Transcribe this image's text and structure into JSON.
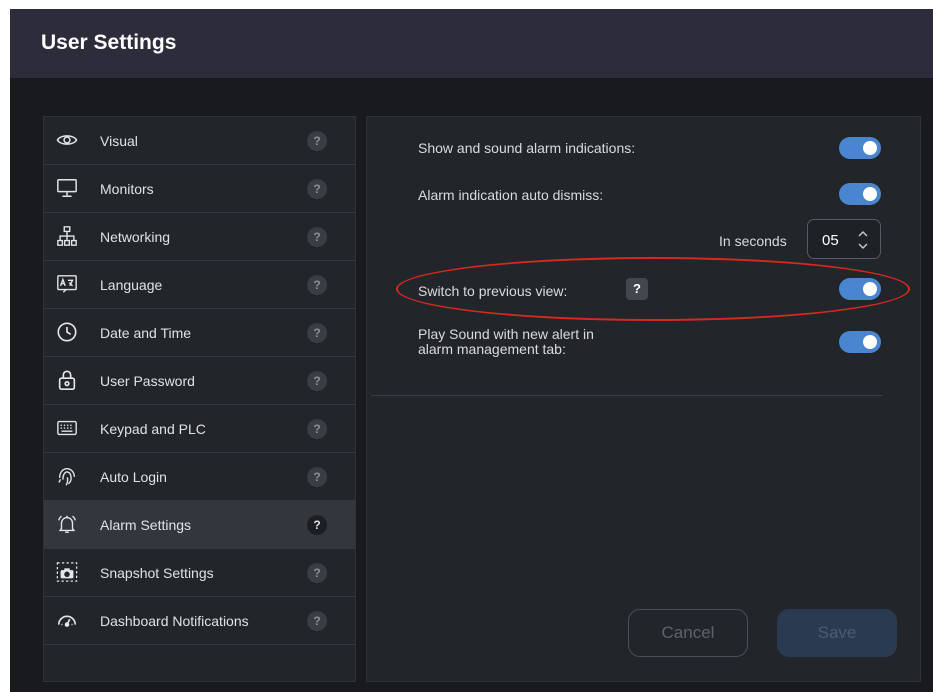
{
  "window": {
    "title": "User Settings"
  },
  "sidebar": {
    "items": [
      {
        "label": "Visual",
        "icon": "eye-icon",
        "help": "?",
        "active": false
      },
      {
        "label": "Monitors",
        "icon": "monitor-icon",
        "help": "?",
        "active": false
      },
      {
        "label": "Networking",
        "icon": "network-icon",
        "help": "?",
        "active": false
      },
      {
        "label": "Language",
        "icon": "language-icon",
        "help": "?",
        "active": false
      },
      {
        "label": "Date and Time",
        "icon": "clock-icon",
        "help": "?",
        "active": false
      },
      {
        "label": "User Password",
        "icon": "lock-icon",
        "help": "?",
        "active": false
      },
      {
        "label": "Keypad and PLC",
        "icon": "keyboard-icon",
        "help": "?",
        "active": false
      },
      {
        "label": "Auto Login",
        "icon": "fingerprint-icon",
        "help": "?",
        "active": false
      },
      {
        "label": "Alarm Settings",
        "icon": "bell-icon",
        "help": "?",
        "active": true
      },
      {
        "label": "Snapshot Settings",
        "icon": "camera-icon",
        "help": "?",
        "active": false
      },
      {
        "label": "Dashboard Notifications",
        "icon": "dashboard-icon",
        "help": "?",
        "active": false
      }
    ]
  },
  "alarm": {
    "show_sound_label": "Show and sound alarm indications:",
    "show_sound_on": true,
    "auto_dismiss_label": "Alarm indication auto dismiss:",
    "auto_dismiss_on": true,
    "seconds_label": "In seconds",
    "seconds_value": "05",
    "switch_prev_label": "Switch to previous view:",
    "switch_prev_help": "?",
    "switch_prev_on": true,
    "play_sound_label_line1": "Play Sound with new alert in",
    "play_sound_label_line2": "alarm management tab:",
    "play_sound_on": true
  },
  "buttons": {
    "cancel": "Cancel",
    "save": "Save"
  },
  "colors": {
    "toggle_on": "#4a86cf",
    "highlight": "#d62a1f",
    "title_bar": "#2d2c3b"
  }
}
